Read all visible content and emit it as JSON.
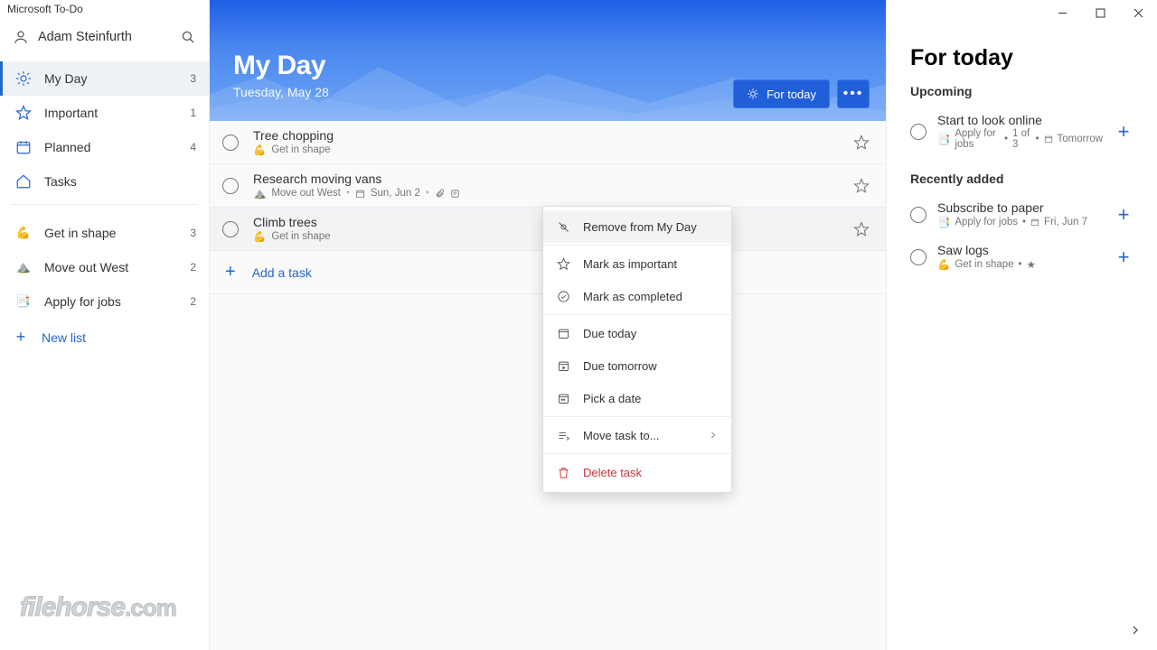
{
  "app_title": "Microsoft To-Do",
  "user": {
    "name": "Adam Steinfurth"
  },
  "sidebar": {
    "builtin": [
      {
        "label": "My Day",
        "count": "3",
        "icon": "sun"
      },
      {
        "label": "Important",
        "count": "1",
        "icon": "star"
      },
      {
        "label": "Planned",
        "count": "4",
        "icon": "calendar"
      },
      {
        "label": "Tasks",
        "count": "",
        "icon": "home"
      }
    ],
    "custom": [
      {
        "label": "Get in shape",
        "count": "3",
        "icon": "💪",
        "tint": "#f5c400"
      },
      {
        "label": "Move out West",
        "count": "2",
        "icon": "⛰️",
        "tint": "#2e8b57"
      },
      {
        "label": "Apply for jobs",
        "count": "2",
        "icon": "📑",
        "tint": "#2564cf"
      }
    ],
    "new_list": "New list"
  },
  "header": {
    "title": "My Day",
    "date": "Tuesday, May 28",
    "for_today": "For today"
  },
  "tasks": [
    {
      "title": "Tree chopping",
      "list": "Get in shape",
      "list_tint": "#f5c400",
      "extra": ""
    },
    {
      "title": "Research moving vans",
      "list": "Move out West",
      "list_tint": "#2e8b57",
      "extra_date": "Sun, Jun 2",
      "has_attach": true,
      "has_note": true
    },
    {
      "title": "Climb trees",
      "list": "Get in shape",
      "list_tint": "#f5c400"
    }
  ],
  "add_task": "Add a task",
  "context_menu": {
    "remove": "Remove from My Day",
    "important": "Mark as important",
    "completed": "Mark as completed",
    "today": "Due today",
    "tomorrow": "Due tomorrow",
    "pick": "Pick a date",
    "move": "Move task to...",
    "delete": "Delete task"
  },
  "suggestions": {
    "title": "For today",
    "upcoming_label": "Upcoming",
    "recent_label": "Recently added",
    "upcoming": [
      {
        "title": "Start to look online",
        "list": "Apply for jobs",
        "list_icon": "📑",
        "progress": "1 of 3",
        "due": "Tomorrow"
      }
    ],
    "recent": [
      {
        "title": "Subscribe to paper",
        "list": "Apply for jobs",
        "list_icon": "📑",
        "due": "Fri, Jun 7"
      },
      {
        "title": "Saw logs",
        "list": "Get in shape",
        "list_icon": "💪",
        "starred": true
      }
    ]
  },
  "watermark": {
    "a": "filehorse",
    "b": ".com"
  }
}
